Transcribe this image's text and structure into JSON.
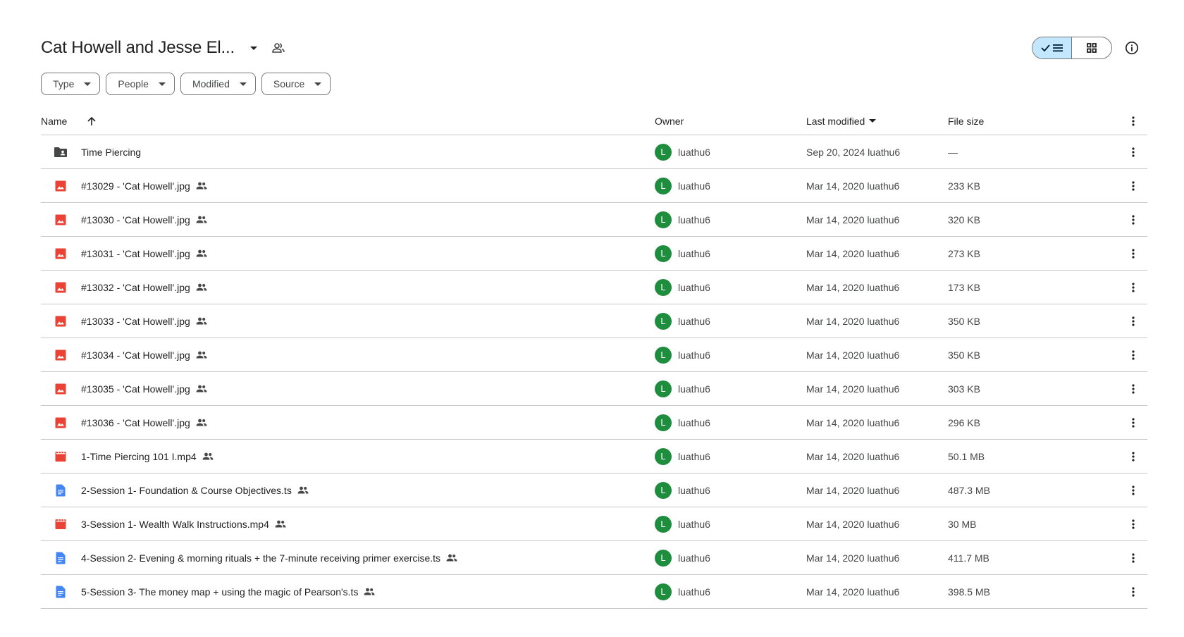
{
  "header": {
    "title": "Cat Howell and Jesse El...",
    "title_menu_icon": "arrow-drop-down-icon",
    "shared_icon": "people-outline-icon",
    "view_list_icon": "check-list-icon",
    "view_grid_icon": "grid-icon",
    "info_icon": "info-icon"
  },
  "filters": [
    "Type",
    "People",
    "Modified",
    "Source"
  ],
  "table": {
    "columns": {
      "name": "Name",
      "owner": "Owner",
      "modified": "Last modified",
      "size": "File size"
    },
    "rows": [
      {
        "name": "Time Piercing",
        "type": "folder",
        "shared": false,
        "owner_initial": "L",
        "owner": "luathu6",
        "modified": "Sep 20, 2024 luathu6",
        "size": "—"
      },
      {
        "name": "#13029 - 'Cat Howell'.jpg",
        "type": "image",
        "shared": true,
        "owner_initial": "L",
        "owner": "luathu6",
        "modified": "Mar 14, 2020 luathu6",
        "size": "233 KB"
      },
      {
        "name": "#13030 - 'Cat Howell'.jpg",
        "type": "image",
        "shared": true,
        "owner_initial": "L",
        "owner": "luathu6",
        "modified": "Mar 14, 2020 luathu6",
        "size": "320 KB"
      },
      {
        "name": "#13031 - 'Cat Howell'.jpg",
        "type": "image",
        "shared": true,
        "owner_initial": "L",
        "owner": "luathu6",
        "modified": "Mar 14, 2020 luathu6",
        "size": "273 KB"
      },
      {
        "name": "#13032 - 'Cat Howell'.jpg",
        "type": "image",
        "shared": true,
        "owner_initial": "L",
        "owner": "luathu6",
        "modified": "Mar 14, 2020 luathu6",
        "size": "173 KB"
      },
      {
        "name": "#13033 - 'Cat Howell'.jpg",
        "type": "image",
        "shared": true,
        "owner_initial": "L",
        "owner": "luathu6",
        "modified": "Mar 14, 2020 luathu6",
        "size": "350 KB"
      },
      {
        "name": "#13034 - 'Cat Howell'.jpg",
        "type": "image",
        "shared": true,
        "owner_initial": "L",
        "owner": "luathu6",
        "modified": "Mar 14, 2020 luathu6",
        "size": "350 KB"
      },
      {
        "name": "#13035 - 'Cat Howell'.jpg",
        "type": "image",
        "shared": true,
        "owner_initial": "L",
        "owner": "luathu6",
        "modified": "Mar 14, 2020 luathu6",
        "size": "303 KB"
      },
      {
        "name": "#13036 - 'Cat Howell'.jpg",
        "type": "image",
        "shared": true,
        "owner_initial": "L",
        "owner": "luathu6",
        "modified": "Mar 14, 2020 luathu6",
        "size": "296 KB"
      },
      {
        "name": "1-Time Piercing 101 I.mp4",
        "type": "video",
        "shared": true,
        "owner_initial": "L",
        "owner": "luathu6",
        "modified": "Mar 14, 2020 luathu6",
        "size": "50.1 MB"
      },
      {
        "name": "2-Session 1- Foundation & Course Objectives.ts",
        "type": "doc",
        "shared": true,
        "owner_initial": "L",
        "owner": "luathu6",
        "modified": "Mar 14, 2020 luathu6",
        "size": "487.3 MB"
      },
      {
        "name": "3-Session 1- Wealth Walk Instructions.mp4",
        "type": "video",
        "shared": true,
        "owner_initial": "L",
        "owner": "luathu6",
        "modified": "Mar 14, 2020 luathu6",
        "size": "30 MB"
      },
      {
        "name": "4-Session 2- Evening & morning rituals + the 7-minute receiving primer exercise.ts",
        "type": "doc",
        "shared": true,
        "owner_initial": "L",
        "owner": "luathu6",
        "modified": "Mar 14, 2020 luathu6",
        "size": "411.7 MB"
      },
      {
        "name": "5-Session 3- The money map + using the magic of Pearson's.ts",
        "type": "doc",
        "shared": true,
        "owner_initial": "L",
        "owner": "luathu6",
        "modified": "Mar 14, 2020 luathu6",
        "size": "398.5 MB"
      }
    ]
  },
  "colors": {
    "folder": "#444746",
    "image": "#ea4335",
    "video": "#ea4335",
    "doc": "#4285f4",
    "avatar": "#1e8e3e",
    "active_view": "#c2e7ff"
  }
}
